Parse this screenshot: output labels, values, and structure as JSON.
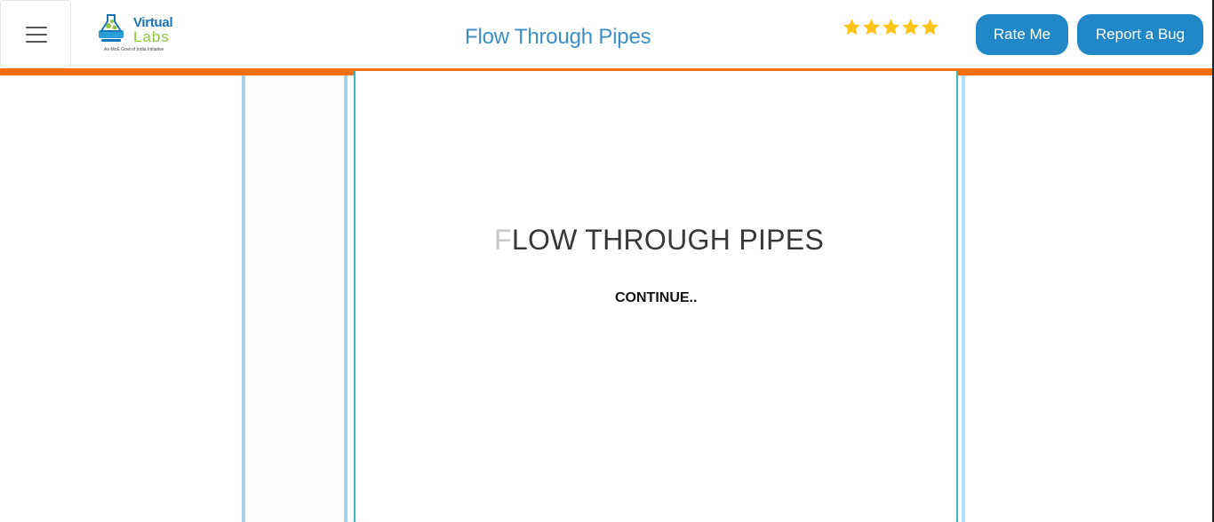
{
  "header": {
    "title": "Flow Through Pipes",
    "logo": {
      "line1": "Virtual",
      "line2": "Labs",
      "tagline": "An MoE Govt of India Initiative"
    },
    "rating": 5,
    "rate_label": "Rate Me",
    "bug_label": "Report a Bug",
    "accent_color": "#f26e08",
    "button_color": "#2187c7",
    "star_color": "#fcc419"
  },
  "main": {
    "heading_first": "F",
    "heading_rest": "LOW THROUGH PIPES",
    "continue_label": "CONTINUE.."
  },
  "icons": [
    "menu-icon",
    "virtual-labs-logo-icon",
    "star-icon"
  ]
}
